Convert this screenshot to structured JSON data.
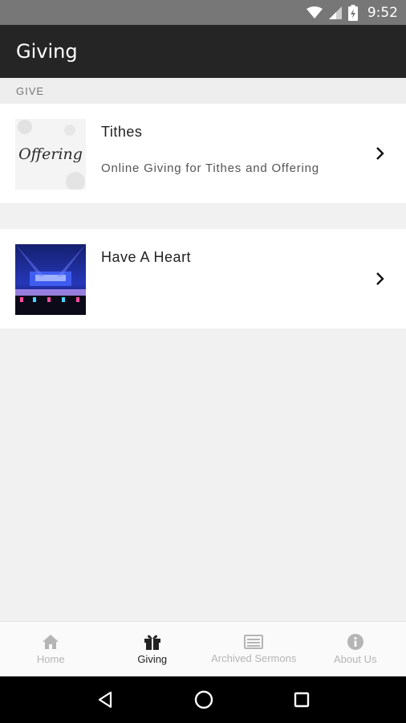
{
  "status_bar": {
    "time": "9:52",
    "icons": [
      "wifi-icon",
      "signal-icon",
      "battery-icon"
    ]
  },
  "app_bar": {
    "title": "Giving"
  },
  "section": {
    "header": "GIVE"
  },
  "items": [
    {
      "title": "Tithes",
      "subtitle": "Online Giving for Tithes and Offering",
      "thumbnail_text": "Offering",
      "icon": "chevron-right-icon"
    },
    {
      "title": "Have A Heart",
      "subtitle": "",
      "icon": "chevron-right-icon"
    }
  ],
  "bottom_nav": [
    {
      "label": "Home",
      "icon": "home-icon",
      "active": false
    },
    {
      "label": "Giving",
      "icon": "gift-icon",
      "active": true
    },
    {
      "label": "Archived Sermons",
      "icon": "sermons-icon",
      "active": false
    },
    {
      "label": "About Us",
      "icon": "info-icon",
      "active": false
    }
  ],
  "system_nav": [
    "back-icon",
    "home-circle-icon",
    "recents-icon"
  ],
  "colors": {
    "app_bar": "#252525",
    "status_bar": "#777777",
    "background": "#f1f1f1",
    "nav_active": "#222222",
    "nav_inactive": "#b5b5b5"
  }
}
